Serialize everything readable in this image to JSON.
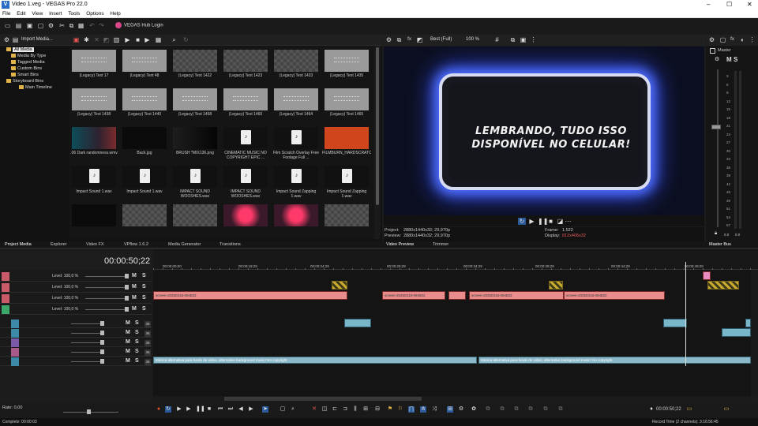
{
  "window": {
    "title": "Video 1.veg - VEGAS Pro 22.0",
    "logo": "V",
    "controls": [
      "–",
      "☐",
      "✕"
    ]
  },
  "menu": [
    "File",
    "Edit",
    "View",
    "Insert",
    "Tools",
    "Options",
    "Help"
  ],
  "toolbar": {
    "hub_label": "VEGAS Hub Login"
  },
  "media": {
    "import_label": "Import Media...",
    "tree": [
      {
        "label": "All Media",
        "selected": true
      },
      {
        "label": "Media By Type"
      },
      {
        "label": "Tagged Media"
      },
      {
        "label": "Custom Bins"
      },
      {
        "label": "Smart Bins"
      },
      {
        "label": "Storyboard Bins"
      },
      {
        "label": "Main Timeline"
      }
    ],
    "items": [
      {
        "name": "(Legacy) Text 17",
        "kind": "text"
      },
      {
        "name": "(Legacy) Text 48",
        "kind": "text"
      },
      {
        "name": "(Legacy) Text 1422",
        "kind": "checker"
      },
      {
        "name": "(Legacy) Text 1423",
        "kind": "checker"
      },
      {
        "name": "(Legacy) Text 1433",
        "kind": "checker"
      },
      {
        "name": "(Legacy) Text 1435",
        "kind": "text"
      },
      {
        "name": "(Legacy) Text 1438",
        "kind": "text"
      },
      {
        "name": "(Legacy) Text 1440",
        "kind": "text"
      },
      {
        "name": "(Legacy) Text 1458",
        "kind": "text"
      },
      {
        "name": "(Legacy) Text 1460",
        "kind": "text"
      },
      {
        "name": "(Legacy) Text 1464",
        "kind": "text"
      },
      {
        "name": "(Legacy) Text 1465",
        "kind": "text"
      },
      {
        "name": ".06 Dark randomness.wmv",
        "kind": "img1"
      },
      {
        "name": "Back.jpg",
        "kind": "dark"
      },
      {
        "name": "BRUSH *MIX136.png",
        "kind": "img2"
      },
      {
        "name": "CINEMATIC MUSIC NO COPYRIGHT  EPIC ...",
        "kind": "doc"
      },
      {
        "name": "Film Scratch Overlay Free Footage   Full ...",
        "kind": "doc"
      },
      {
        "name": "FILMBURN_HARDSCRATCH_001.mp4",
        "kind": "red"
      },
      {
        "name": "Impact Sound 1.wav",
        "kind": "doc"
      },
      {
        "name": "Impact Sound 1.wav",
        "kind": "doc"
      },
      {
        "name": "IMPACT SOUND WOOSHES.wav",
        "kind": "doc"
      },
      {
        "name": "IMPACT SOUND WOOSHES.wav",
        "kind": "doc"
      },
      {
        "name": "Impact Sound Zapping 1.wav",
        "kind": "doc"
      },
      {
        "name": "Impact Sound Zapping 1.wav",
        "kind": "doc"
      },
      {
        "name": "",
        "kind": "dark"
      },
      {
        "name": "",
        "kind": "checker"
      },
      {
        "name": "",
        "kind": "checker"
      },
      {
        "name": "",
        "kind": "img3"
      },
      {
        "name": "",
        "kind": "img3"
      },
      {
        "name": "",
        "kind": "checker"
      }
    ]
  },
  "preview": {
    "quality": "Best (Full)",
    "zoom": "100 %",
    "caption": "LEMBRANDO, TUDO ISSO DISPONÍVEL NO CELULAR!",
    "project_label": "Project:",
    "project_value": "2880x1440x32; 29,970p",
    "preview_label": "Preview:",
    "preview_value": "2880x1440x32; 29,970p",
    "frame_label": "Frame:",
    "frame_value": "1.522",
    "display_label": "Display:",
    "display_value": "812x406x32"
  },
  "master": {
    "label": "Master",
    "bus_tab": "Master Bus",
    "db_labels": [
      "3",
      "6",
      "9",
      "12",
      "15",
      "18",
      "21",
      "24",
      "27",
      "30",
      "33",
      "36",
      "39",
      "42",
      "45",
      "48",
      "51",
      "54",
      "57"
    ],
    "bottom": [
      "0.0",
      "0.0"
    ]
  },
  "tabs": [
    "Project Media",
    "Explorer",
    "Video FX",
    "VPflow 1.6.2",
    "Media Generator",
    "Transitions",
    "Video Preview",
    "Trimmer"
  ],
  "timeline": {
    "time": "00:00:50;22",
    "ruler": [
      "00:00:00;00",
      "00:00:19;29",
      "00:00:24;29",
      "00:00:29;29",
      "00:00:34;29",
      "00:00:39;29",
      "00:00:44;29",
      "00:00:49;29"
    ],
    "video_tracks": [
      {
        "level": "Level: 100,0 %",
        "color": "#c95a6a",
        "num": "1"
      },
      {
        "level": "Level: 100,0 %",
        "color": "#c95a6a",
        "num": "2"
      },
      {
        "level": "Level: 100,0 %",
        "color": "#c95a6a",
        "num": "3"
      },
      {
        "level": "Level: 100,0 %",
        "color": "#3ca86a",
        "num": "4"
      }
    ],
    "audio_tracks": [
      {
        "color": "#3c8aa8",
        "num": "36"
      },
      {
        "color": "#3c8aa8",
        "num": "36"
      },
      {
        "color": "#7a5aa8",
        "num": "36"
      },
      {
        "color": "#a85a8a",
        "num": "36"
      },
      {
        "color": "#3c8aa8",
        "num": "36"
      }
    ],
    "clip_screen": "screen-20250318-094822",
    "music_clip": "Música alternativa para fundo de vídeo, alternative background music! No copyright."
  },
  "bottom": {
    "rate": "Rate: 0,00",
    "end_time": "00:00:50;22",
    "complete": "Complete: 00:00:03",
    "record": "Record Time (2 channels): 3:16:56:45"
  }
}
